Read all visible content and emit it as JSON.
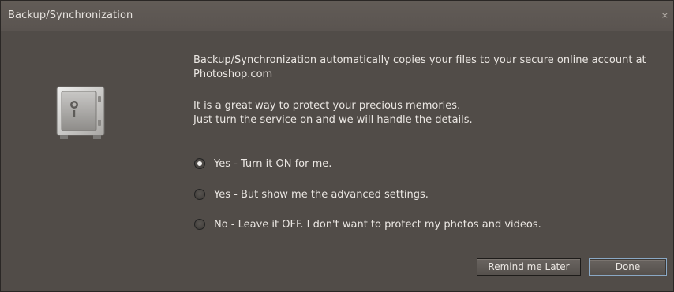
{
  "window": {
    "title": "Backup/Synchronization",
    "close_glyph": "×"
  },
  "icon": "safe-icon",
  "intro": {
    "line1": "Backup/Synchronization automatically copies your files to your secure online account at Photoshop.com",
    "line2": "It is a great way to protect your precious memories.",
    "line3": "Just turn the service on and we will handle the details."
  },
  "options": [
    {
      "label": "Yes - Turn it ON for me.",
      "selected": true
    },
    {
      "label": "Yes - But show me the advanced settings.",
      "selected": false
    },
    {
      "label": "No - Leave it OFF. I don't want to protect my photos and videos.",
      "selected": false
    }
  ],
  "buttons": {
    "remind": "Remind me Later",
    "done": "Done"
  },
  "colors": {
    "background": "#514c48",
    "focus_border": "#8aa8c4"
  }
}
